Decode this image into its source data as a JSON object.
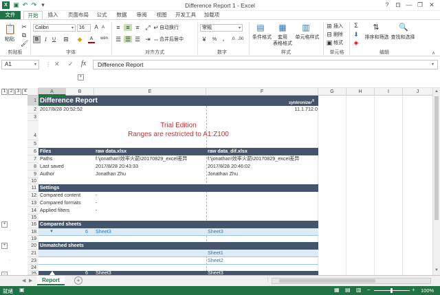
{
  "window": {
    "title": "Difference Report 1 - Excel",
    "controls": {
      "help": "?",
      "ribbon_display": "⊡",
      "minimize": "—",
      "maximize": "❐",
      "close": "✕"
    }
  },
  "qat": {
    "save": "▣",
    "undo": "↶",
    "redo": "↷",
    "customize": "▾"
  },
  "tabs": [
    "文件",
    "开始",
    "插入",
    "页面布局",
    "公式",
    "数据",
    "审阅",
    "视图",
    "开发工具",
    "加载项"
  ],
  "ribbon": {
    "clipboard": {
      "paste": "粘贴",
      "label": "剪贴板"
    },
    "font": {
      "name": "Calibri",
      "size": "16",
      "bold": "B",
      "italic": "I",
      "underline": "U",
      "grow": "A",
      "shrink": "A",
      "color_letter": "A",
      "label": "字体",
      "glyph": "wén"
    },
    "alignment": {
      "wrap": "自动换行",
      "merge": "合并后居中",
      "label": "对齐方式"
    },
    "number": {
      "format": "常规",
      "percent": "%",
      "comma": ",",
      "label": "数字"
    },
    "styles": {
      "conditional": "条件格式",
      "table": "套用\n表格格式",
      "cell": "单元格样式",
      "label": "样式"
    },
    "cells": {
      "insert": "插入",
      "delete": "删除",
      "format": "格式",
      "label": "单元格"
    },
    "editing": {
      "sort": "排序和筛选",
      "find": "查找和选择",
      "sum": "Σ",
      "label": "编辑"
    }
  },
  "formula_bar": {
    "name_box": "A1",
    "fx": "fx",
    "cancel": "✕",
    "enter": "✓",
    "value": "Difference Report"
  },
  "outline": {
    "levels": [
      "1",
      "2",
      "3",
      "4"
    ],
    "plus": "+",
    "minus": "−",
    "dot": "·"
  },
  "columns": [
    "A",
    "B",
    "E",
    "F",
    "G",
    "H",
    "I",
    "J"
  ],
  "rows": [
    "1",
    "2",
    "3",
    "4",
    "5",
    "6",
    "7",
    "8",
    "9",
    "10",
    "11",
    "12",
    "13",
    "14",
    "15",
    "16",
    "18",
    "19",
    "20",
    "21",
    "23",
    "24",
    "25"
  ],
  "sheet": {
    "title": "Difference Report",
    "brand": "synkronizer",
    "brand_mark": "®",
    "timestamp": "2017/8/28 20:52:52",
    "version": "11.1.712.0",
    "trial_line1": "Trial Edition",
    "trial_line2": "Ranges are restricted to A1:Z100",
    "files_header": "Files",
    "file1_name": "raw data.xlsx",
    "file2_name": "raw data_dif.xlsx",
    "paths_label": "Paths",
    "path1": "f:\\jonathan\\效率火箭\\20170829_excel差异",
    "path2": "f:\\jonathan\\效率火箭\\20170829_excel差异",
    "last_saved_label": "Last saved",
    "saved1": "2017/8/28 20:43:33",
    "saved2": "2017/8/28 20:46:02",
    "author_label": "Author",
    "author1": "Jonathan Zhu",
    "author2": "Jonathan Zhu",
    "settings_header": "Settings",
    "compared_content": "Compared content",
    "compared_formats": "Compared formats",
    "applied_filters": "Applied filters",
    "dash": "-",
    "compared_sheets_header": "Compared sheets",
    "row18_arrow": "▼",
    "row18_count": "6",
    "row18_sheet1": "Sheet3",
    "row18_sheet2": "Sheet3",
    "unmatched_header": "Unmatched sheets",
    "unmatched1": "Sheet1",
    "unmatched2": "Sheet2",
    "row25_count": "6",
    "row25_sheet1": "Sheet3",
    "row25_sheet2": "Sheet3"
  },
  "sheet_tabs": {
    "active": "Report",
    "add": "+",
    "prev": "◀",
    "next": "▶"
  },
  "status": {
    "mode": "就绪",
    "zoom": "100%",
    "zoom_minus": "−",
    "zoom_plus": "+"
  }
}
